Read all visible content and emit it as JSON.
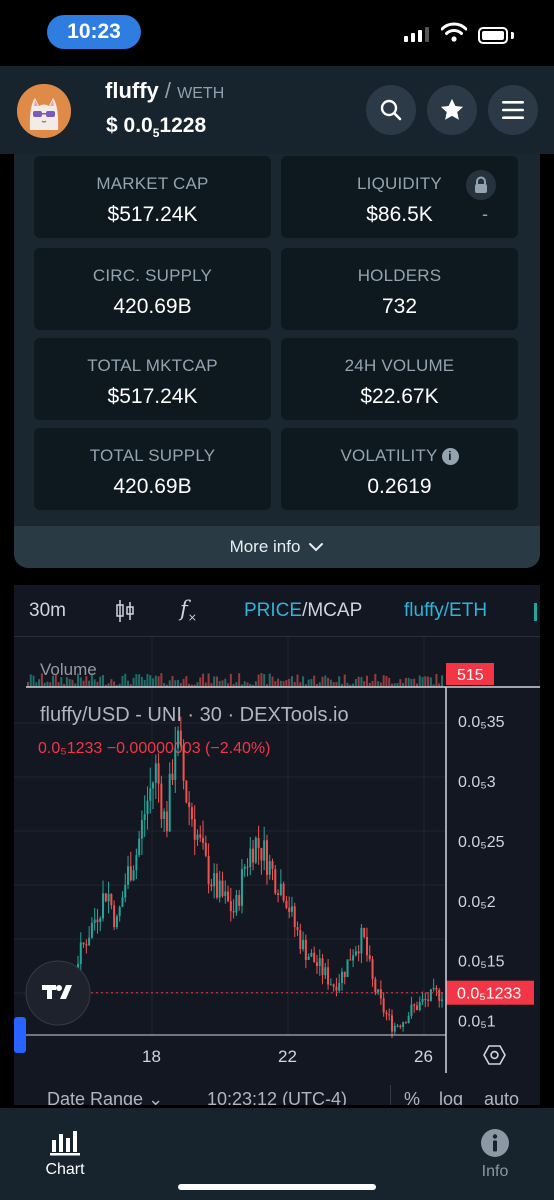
{
  "status": {
    "time": "10:23"
  },
  "header": {
    "token": "fluffy",
    "separator": "/",
    "pair": "WETH",
    "price_prefix": "$ 0.0",
    "price_sub": "5",
    "price_rest": "1228"
  },
  "stats": [
    {
      "label": "MARKET CAP",
      "value": "$517.24K"
    },
    {
      "label": "LIQUIDITY",
      "value": "$86.5K",
      "extra": "-"
    },
    {
      "label": "CIRC. SUPPLY",
      "value": "420.69B"
    },
    {
      "label": "HOLDERS",
      "value": "732"
    },
    {
      "label": "TOTAL MKTCAP",
      "value": "$517.24K"
    },
    {
      "label": "24H VOLUME",
      "value": "$22.67K"
    },
    {
      "label": "TOTAL SUPPLY",
      "value": "420.69B"
    },
    {
      "label": "VOLATILITY",
      "value": "0.2619"
    }
  ],
  "more_info": {
    "label": "More info"
  },
  "chart_toolbar": {
    "interval": "30m",
    "fx": "f",
    "price": "PRICE",
    "slash": "/",
    "mcap": "MCAP",
    "pair": "fluffy/ETH"
  },
  "chart_data": {
    "type": "candlestick",
    "title": "fluffy/USD - UNI · 30 · DEXTools.io",
    "ohlc_label": "0.0₅1233 −0.00000003 (−2.40%)",
    "volume_label": "Volume",
    "volume_value": "515",
    "last_price": "0.0₅1233",
    "y_ticks": [
      "0.0₅35",
      "0.0₅3",
      "0.0₅25",
      "0.0₅2",
      "0.0₅15",
      "0.0₅1"
    ],
    "y_tick_values": [
      3.5e-06,
      3e-06,
      2.5e-06,
      2e-06,
      1.5e-06,
      1e-06
    ],
    "x_ticks": [
      "18",
      "22",
      "26"
    ],
    "ylim": [
      8.8e-07,
      3.7e-06
    ],
    "close_series": [
      1.2e-06,
      1.25e-06,
      1.3e-06,
      1.2e-06,
      1.28e-06,
      1.5e-06,
      1.7e-06,
      1.9e-06,
      2.1e-06,
      1.8e-06,
      2.2e-06,
      2.4e-06,
      2.8e-06,
      3.1e-06,
      2.6e-06,
      3.4e-06,
      2.9e-06,
      2.6e-06,
      2.3e-06,
      2.1e-06,
      2e-06,
      1.9e-06,
      2.3e-06,
      2.5e-06,
      2.4e-06,
      2.2e-06,
      2.1e-06,
      1.8e-06,
      1.6e-06,
      1.5e-06,
      1.4e-06,
      1.3e-06,
      1.4e-06,
      1.6e-06,
      1.7e-06,
      1.3e-06,
      1.1e-06,
      9.5e-07,
      1e-06,
      1.1e-06,
      1.15e-06,
      1.2e-06,
      1.233e-06
    ],
    "date_range": "Date Range",
    "clock": "10:23:12 (UTC-4)",
    "pct": "%",
    "log": "log",
    "auto": "auto"
  },
  "bottom_nav": {
    "chart": "Chart",
    "info": "Info"
  }
}
